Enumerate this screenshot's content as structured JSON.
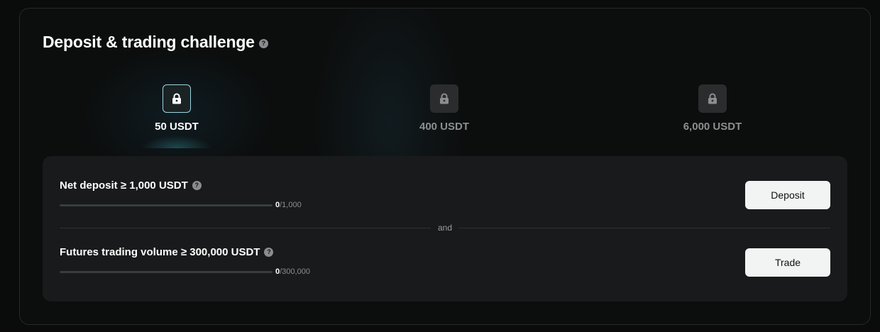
{
  "challenge": {
    "title": "Deposit & trading challenge",
    "help_glyph": "?"
  },
  "tiers": [
    {
      "label": "50 USDT",
      "state": "current",
      "icon": "lock-icon"
    },
    {
      "label": "400 USDT",
      "state": "locked",
      "icon": "lock-icon"
    },
    {
      "label": "6,000 USDT",
      "state": "locked",
      "icon": "lock-icon"
    }
  ],
  "tasks": {
    "deposit": {
      "title": "Net deposit ≥ 1,000 USDT",
      "current": "0",
      "target": "/1,000",
      "progress": 0,
      "button": "Deposit"
    },
    "separator": "and",
    "trade": {
      "title": "Futures trading volume ≥ 300,000 USDT",
      "current": "0",
      "target": "/300,000",
      "progress": 0,
      "button": "Trade"
    }
  },
  "colors": {
    "accent": "#9ad6e0",
    "button_bg": "#f2f3f3",
    "panel_bg": "#0c0d0d",
    "card_bg": "#181a1b"
  }
}
